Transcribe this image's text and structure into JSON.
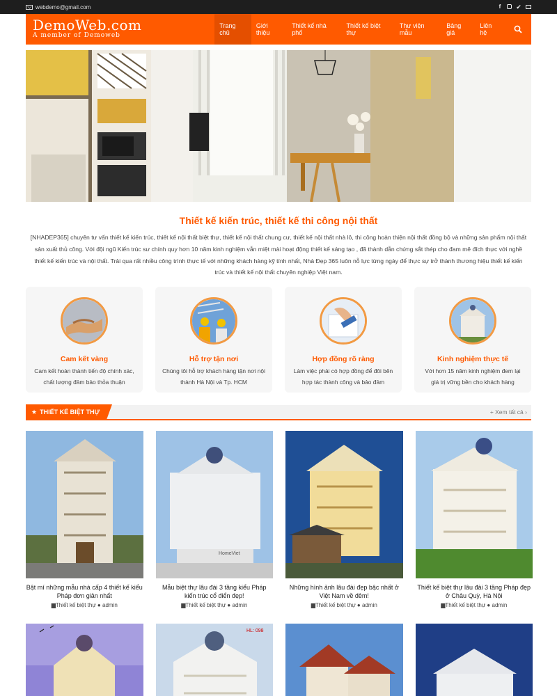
{
  "topbar": {
    "email": "webdemo@gmail.com"
  },
  "header": {
    "logo_name": "DemoWeb.com",
    "logo_sub": "A member of Demoweb"
  },
  "nav": [
    "Trang chủ",
    "Giới thiệu",
    "Thiết kế nhà phố",
    "Thiết kế biệt thự",
    "Thư viện mẫu",
    "Bảng giá",
    "Liên hệ"
  ],
  "intro": {
    "title": "Thiết kế kiến trúc, thiết kế thi công nội thất",
    "text": "[NHADEP365] chuyên tư vấn thiết kế kiến trúc, thiết kế nội thất biệt thự, thiết kế nội thất chung cư, thiết kế nội thất nhà lô, thi công hoàn thiện nội thất đồng bộ và những sản phẩm nội thất sản xuất thủ công. Với đội ngũ Kiến trúc sư chính quy hơn 10 năm kinh nghiệm vẫn miệt mài hoạt động thiết kế sáng tạo , đã thành dẫn chứng sắt thép cho đam mê đích thực với nghề thiết kế kiến trúc và nội thất. Trải qua rất nhiều công trình thực tế với những khách hàng kỹ tính nhất, Nhà Đẹp 365 luôn nỗ lực từng ngày để thực sự trở thành thương hiệu thiết kế kiến trúc và thiết kế nội thất chuyên nghiệp Việt nam."
  },
  "features": [
    {
      "title": "Cam kết vàng",
      "desc": "Cam kết hoàn thành tiến độ chính xác, chất lượng đảm bảo thỏa thuận"
    },
    {
      "title": "Hỗ trợ tận nơi",
      "desc": "Chúng tôi hỗ trợ khách hàng tận nơi nội thành Hà Nội và Tp. HCM"
    },
    {
      "title": "Hợp đồng rõ ràng",
      "desc": "Làm việc phải có hợp đồng để đôi bên hợp tác thành công và bảo đảm"
    },
    {
      "title": "Kinh nghiệm thực tế",
      "desc": "Với hơn 15 năm kinh nghiệm đem lại giá trị vững bền cho khách hàng"
    }
  ],
  "section": {
    "title": "THIẾT KẾ BIỆT THỰ",
    "see_all": "+ Xem tất cả"
  },
  "posts": [
    {
      "title": "Bật mí những mẫu nhà cấp 4 thiết kế kiểu Pháp đơn giản nhất",
      "category": "Thiết kế biệt thự",
      "author": "admin"
    },
    {
      "title": "Mẫu biệt thự lâu đài 3 tầng kiểu Pháp kiến trúc cổ điển đẹp!",
      "category": "Thiết kế biệt thự",
      "author": "admin"
    },
    {
      "title": "Những hình ảnh lâu đài đẹp bậc nhất ở Việt Nam về đêm!",
      "category": "Thiết kế biệt thự",
      "author": "admin"
    },
    {
      "title": "Thiết kế biệt thự lâu đài 3 tầng Pháp đẹp ở Châu Quỳ, Hà Nội",
      "category": "Thiết kế biệt thự",
      "author": "admin"
    }
  ],
  "thumb_labels": {
    "homeviet": "HomeViet",
    "hl": "HL: 098"
  },
  "colors": {
    "accent": "#ff5a00",
    "topbar": "#1e1e1e"
  }
}
